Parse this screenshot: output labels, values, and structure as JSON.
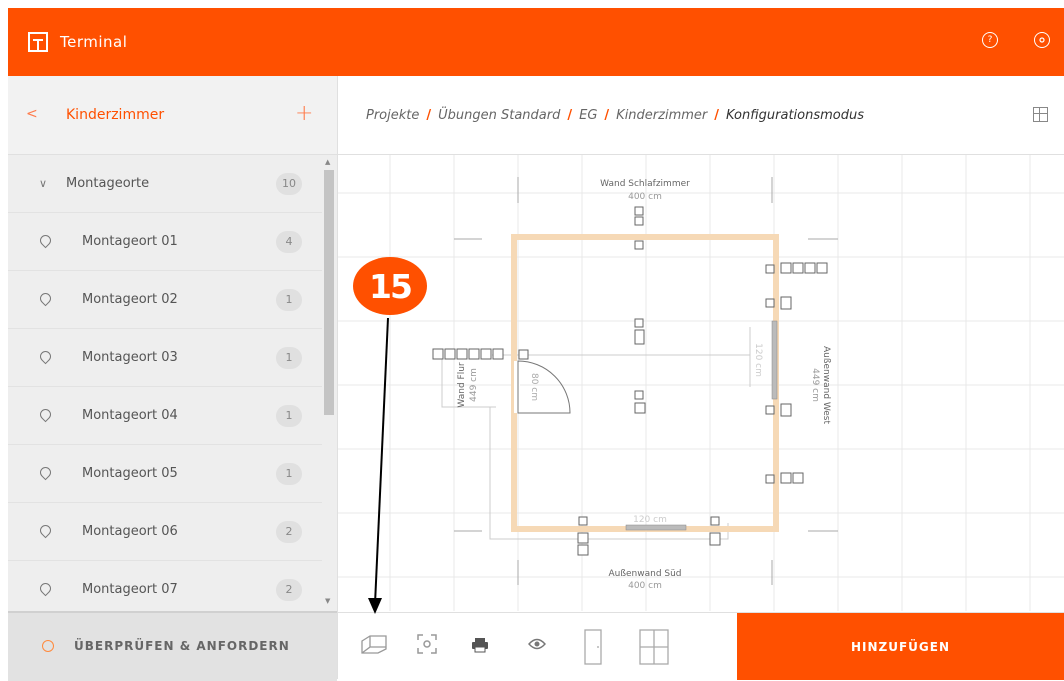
{
  "app": {
    "title": "Terminal"
  },
  "header": {
    "help_icon": "help-icon",
    "settings_icon": "gear-icon"
  },
  "sidebar": {
    "title": "Kinderzimmer",
    "group": {
      "label": "Montageorte",
      "count": "10"
    },
    "items": [
      {
        "label": "Montageort 01",
        "count": "4"
      },
      {
        "label": "Montageort 02",
        "count": "1"
      },
      {
        "label": "Montageort 03",
        "count": "1"
      },
      {
        "label": "Montageort 04",
        "count": "1"
      },
      {
        "label": "Montageort 05",
        "count": "1"
      },
      {
        "label": "Montageort 06",
        "count": "2"
      },
      {
        "label": "Montageort 07",
        "count": "2"
      }
    ],
    "footer_label": "ÜBERPRÜFEN & ANFORDERN"
  },
  "breadcrumb": {
    "items": [
      "Projekte",
      "Übungen Standard",
      "EG",
      "Kinderzimmer"
    ],
    "current": "Konfigurationsmodus"
  },
  "plan": {
    "top_wall": "Wand Schlafzimmer",
    "top_dim": "400 cm",
    "bottom_wall": "Außenwand Süd",
    "bottom_dim": "400 cm",
    "left_wall": "Wand Flur",
    "left_dim": "449 cm",
    "right_wall": "Außenwand West",
    "right_dim": "449 cm",
    "door_dim": "80 cm",
    "window_right_dim": "120 cm",
    "window_bottom_dim": "120 cm"
  },
  "toolbar": {
    "add_label": "HINZUFÜGEN",
    "icons": [
      "room-icon",
      "screenshot-icon",
      "print-icon",
      "eye-icon",
      "door-icon",
      "window-icon"
    ]
  },
  "annotation": {
    "badge": "15"
  },
  "colors": {
    "accent": "#ff5000",
    "room_wall": "#f6d9b6"
  }
}
